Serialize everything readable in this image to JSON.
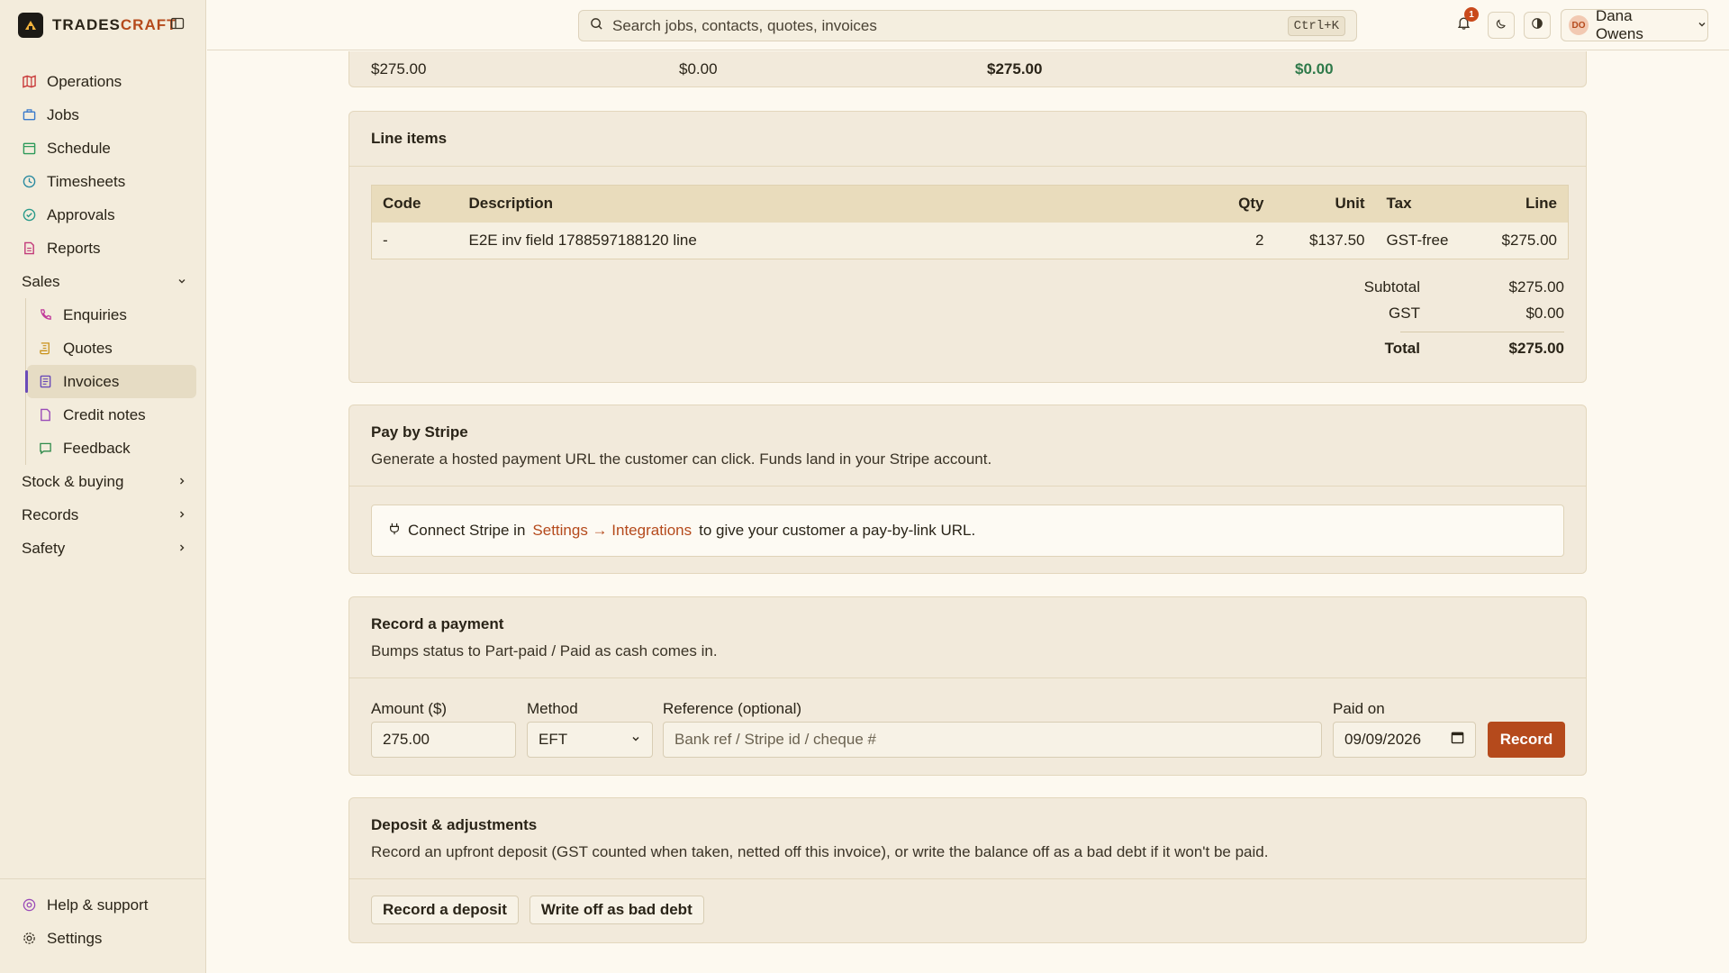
{
  "brand": {
    "name_a": "TRADES",
    "name_b": "CRAFT"
  },
  "sidebar": {
    "items": [
      {
        "label": "Operations"
      },
      {
        "label": "Jobs"
      },
      {
        "label": "Schedule"
      },
      {
        "label": "Timesheets"
      },
      {
        "label": "Approvals"
      },
      {
        "label": "Reports"
      }
    ],
    "sales": {
      "label": "Sales",
      "items": [
        {
          "label": "Enquiries"
        },
        {
          "label": "Quotes"
        },
        {
          "label": "Invoices"
        },
        {
          "label": "Credit notes"
        },
        {
          "label": "Feedback"
        }
      ]
    },
    "groups": [
      {
        "label": "Stock & buying"
      },
      {
        "label": "Records"
      },
      {
        "label": "Safety"
      }
    ],
    "footer": [
      {
        "label": "Help & support"
      },
      {
        "label": "Settings"
      }
    ]
  },
  "topbar": {
    "search_placeholder": "Search jobs, contacts, quotes, invoices",
    "shortcut": "Ctrl+K",
    "notif_count": "1",
    "user_initials": "DO",
    "user_name": "Dana Owens"
  },
  "summary": {
    "v1": "$275.00",
    "v2": "$0.00",
    "v3": "$275.00",
    "v4": "$0.00"
  },
  "line_items": {
    "title": "Line items",
    "headers": {
      "code": "Code",
      "description": "Description",
      "qty": "Qty",
      "unit": "Unit",
      "tax": "Tax",
      "line": "Line"
    },
    "rows": [
      {
        "code": "-",
        "description": "E2E inv field 1788597188120 line",
        "qty": "2",
        "unit": "$137.50",
        "tax": "GST-free",
        "line": "$275.00"
      }
    ],
    "subtotal_label": "Subtotal",
    "subtotal": "$275.00",
    "gst_label": "GST",
    "gst": "$0.00",
    "total_label": "Total",
    "total": "$275.00"
  },
  "stripe": {
    "title": "Pay by Stripe",
    "desc": "Generate a hosted payment URL the customer can click. Funds land in your Stripe account.",
    "notice_pre": "Connect Stripe in",
    "notice_link": "Settings → Integrations",
    "notice_post": "to give your customer a pay-by-link URL."
  },
  "payment": {
    "title": "Record a payment",
    "desc": "Bumps status to Part-paid / Paid as cash comes in.",
    "amount_label": "Amount ($)",
    "amount_value": "275.00",
    "method_label": "Method",
    "method_value": "EFT",
    "reference_label": "Reference (optional)",
    "reference_placeholder": "Bank ref / Stripe id / cheque #",
    "paid_on_label": "Paid on",
    "paid_on_value": "09/09/2026",
    "record_label": "Record"
  },
  "deposit": {
    "title": "Deposit & adjustments",
    "desc": "Record an upfront deposit (GST counted when taken, netted off this invoice), or write the balance off as a bad debt if it won't be paid.",
    "deposit_btn": "Record a deposit",
    "writeoff_btn": "Write off as bad debt"
  },
  "colors": {
    "accent": "#b54a1c",
    "paid_green": "#2f7a4a"
  }
}
